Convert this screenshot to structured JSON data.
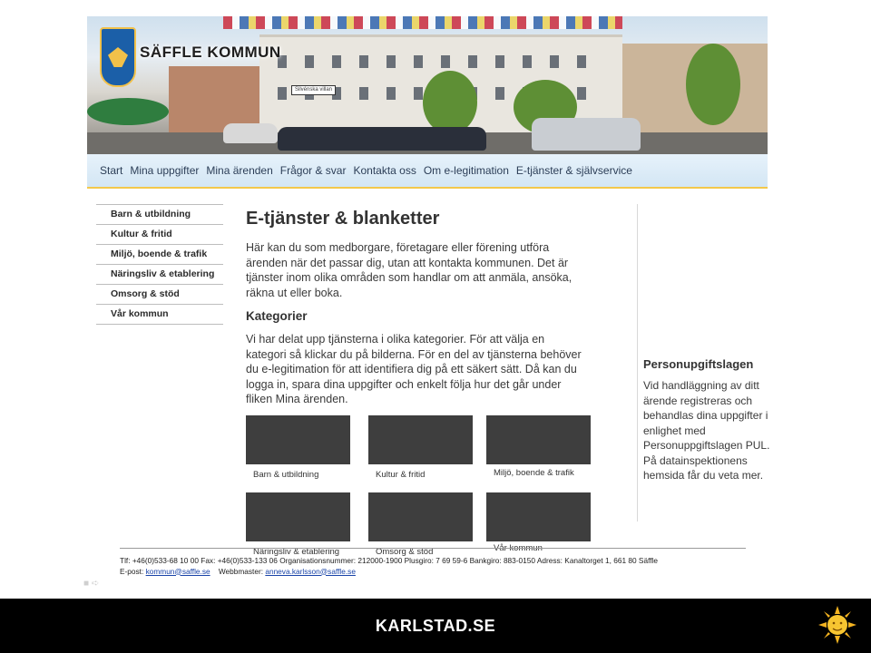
{
  "brand": {
    "name": "SÄFFLE KOMMUN",
    "street_sign": "Silvénska villan"
  },
  "nav": [
    "Start",
    "Mina uppgifter",
    "Mina ärenden",
    "Frågor & svar",
    "Kontakta oss",
    "Om e-legitimation",
    "E-tjänster & självservice"
  ],
  "sidebar": [
    "Barn & utbildning",
    "Kultur & fritid",
    "Miljö, boende & trafik",
    "Näringsliv & etablering",
    "Omsorg & stöd",
    "Vår kommun"
  ],
  "main": {
    "title": "E-tjänster & blanketter",
    "intro": "Här kan du som medborgare, företagare eller förening utföra ärenden när det passar dig, utan att kontakta kommunen. Det är tjänster inom olika områden som handlar om att anmäla, ansöka, räkna ut eller boka.",
    "category_heading": "Kategorier",
    "category_text": "Vi har delat upp tjänsterna i olika kategorier. För att välja en kategori så klickar du på bilderna. För en del av tjänsterna behöver du e-legitimation för att identifiera dig på ett säkert sätt. Då kan du logga in, spara dina uppgifter och enkelt följa hur det går under fliken Mina ärenden."
  },
  "categories": [
    "Barn & utbildning",
    "Kultur & fritid",
    "Miljö, boende & trafik",
    "Näringsliv & etablering",
    "Omsorg & stöd",
    "Vår kommun"
  ],
  "aside": {
    "title": "Personupgiftslagen",
    "text": "Vid handläggning av ditt ärende registreras och behandlas dina uppgifter i enlighet med Personuppgiftslagen PUL. På datainspektionens hemsida får du veta mer."
  },
  "footer": {
    "line1": "Tlf: +46(0)533-68 10 00   Fax: +46(0)533-133 06   Organisationsnummer: 212000-1900   Plusgiro: 7 69 59-6   Bankgiro: 883-0150   Adress: Kanaltorget 1, 661 80 Säffle",
    "email_label": "E-post:",
    "email": "kommun@saffle.se",
    "webmaster_label": "Webbmaster:",
    "webmaster": "anneva.karlsson@saffle.se"
  },
  "bottom_bar": {
    "text": "KARLSTAD.SE",
    "logo_icon": "sun-logo-icon"
  }
}
